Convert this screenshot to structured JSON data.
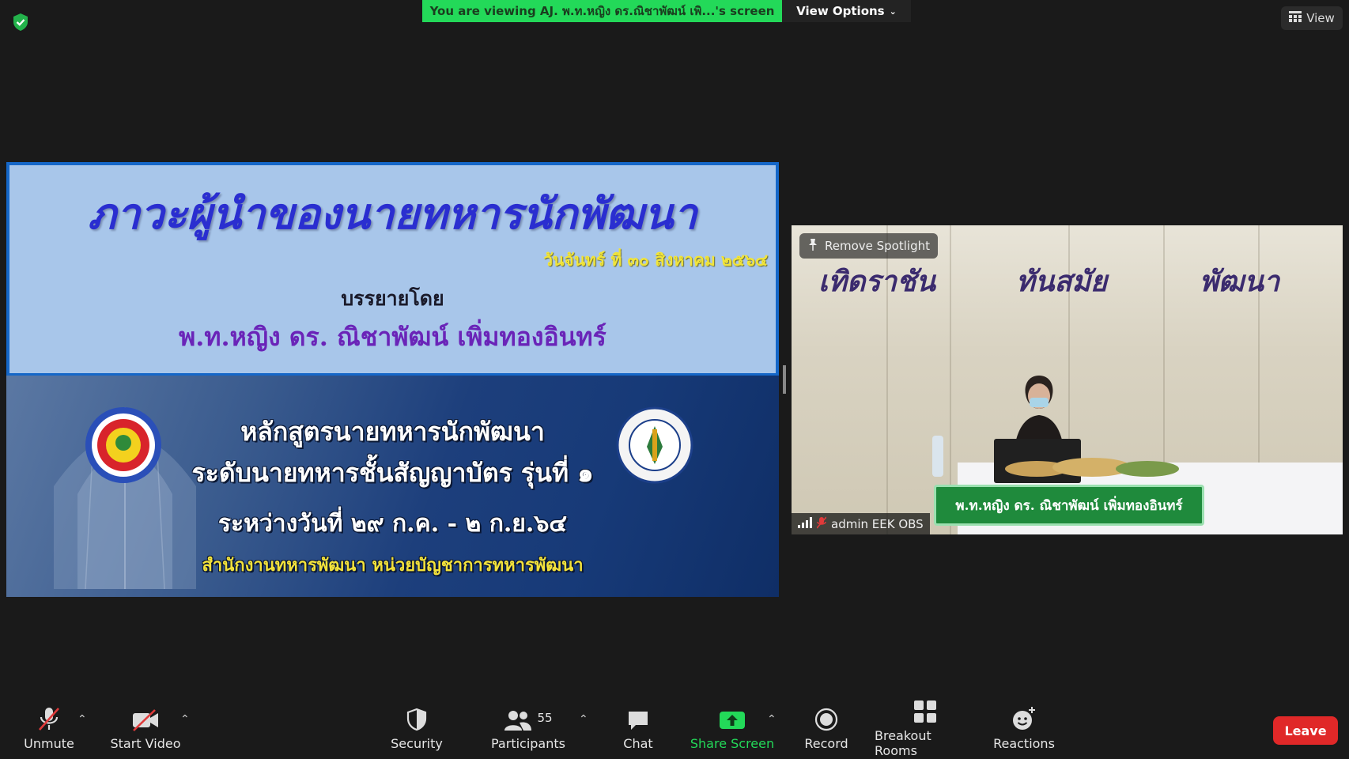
{
  "top_bar": {
    "viewing_banner": "You are viewing AJ. พ.ท.หญิง ดร.ณิชาพัฒน์ เพิ...'s screen",
    "view_options": "View Options",
    "view_button": "View"
  },
  "slide": {
    "title": "ภาวะผู้นำของนายทหารนักพัฒนา",
    "date": "วันจันทร์ ที่ ๓๐ สิงหาคม ๒๕๖๔",
    "by": "บรรยายโดย",
    "speaker": "พ.ท.หญิง ดร. ณิชาพัฒน์  เพิ่มทองอินทร์",
    "course_line1": "หลักสูตรนายทหารนักพัฒนา",
    "course_line2": "ระดับนายทหารชั้นสัญญาบัตร รุ่นที่ ๑",
    "course_dates": "ระหว่างวันที่ ๒๙ ก.ค. - ๒ ก.ย.๖๔",
    "organization": "สำนักงานทหารพัฒนา หน่วยบัญชาการทหารพัฒนา"
  },
  "video": {
    "remove_spotlight": "Remove Spotlight",
    "wall_word_1": "เทิดราชัน",
    "wall_word_2": "ทันสมัย",
    "wall_word_3": "พัฒนา",
    "name_sign": "พ.ท.หญิง ดร. ณิชาพัฒน์  เพิ่มทองอินทร์",
    "participant_name": "admin EEK OBS"
  },
  "toolbar": {
    "unmute": "Unmute",
    "start_video": "Start Video",
    "security": "Security",
    "participants": "Participants",
    "participants_count": "55",
    "chat": "Chat",
    "share_screen": "Share Screen",
    "record": "Record",
    "breakout_rooms": "Breakout Rooms",
    "reactions": "Reactions",
    "leave": "Leave"
  },
  "colors": {
    "banner_green": "#23d959",
    "leave_red": "#e02828",
    "share_green": "#23d959",
    "slide_title_blue": "#2a2ed0",
    "slide_speaker_purple": "#6a24b8"
  }
}
